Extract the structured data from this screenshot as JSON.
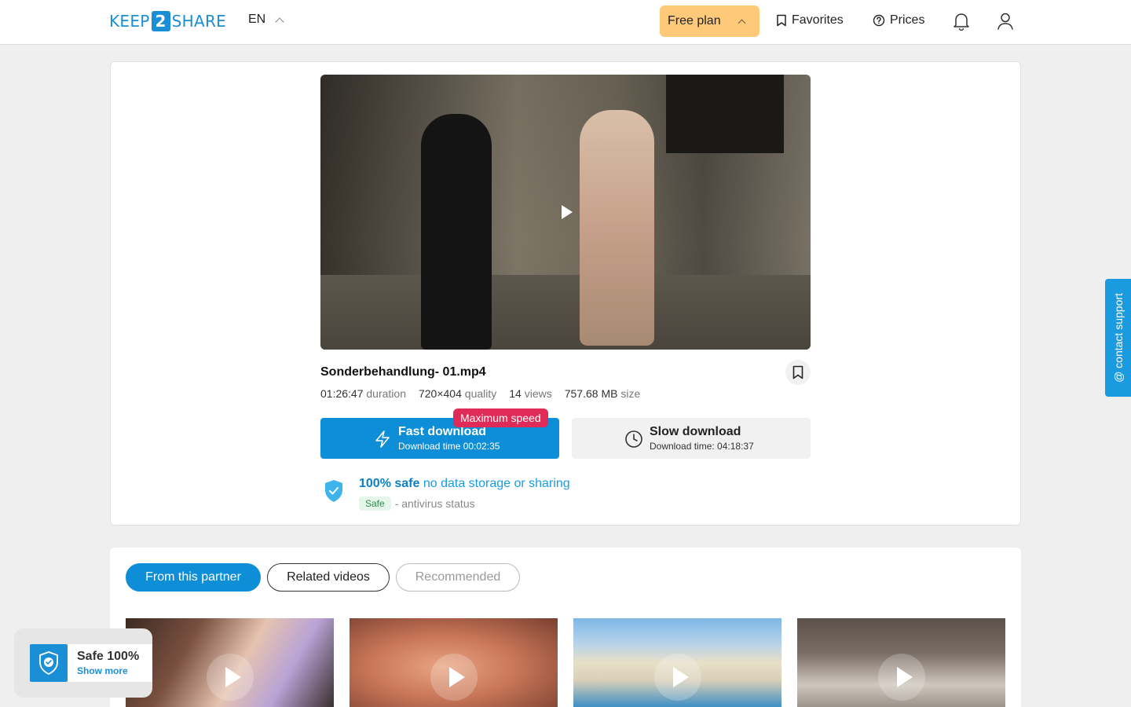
{
  "header": {
    "logo": {
      "part1": "KEEP",
      "part2": "2",
      "part3": "SHARE"
    },
    "language": "EN",
    "plan_label": "Free plan",
    "favorites_label": "Favorites",
    "prices_label": "Prices",
    "icons": {
      "bookmark": "bookmark-icon",
      "help": "help-circle-icon",
      "bell": "bell-icon",
      "user": "user-icon"
    }
  },
  "file": {
    "title": "Sonderbehandlung- 01.mp4",
    "duration_value": "01:26:47",
    "duration_label": "duration",
    "quality_value": "720×404",
    "quality_label": "quality",
    "views_value": "14",
    "views_label": "views",
    "size_value": "757.68 MB",
    "size_label": "size"
  },
  "download": {
    "badge": "Maximum speed",
    "fast_title": "Fast download",
    "fast_time": "Download time 00:02:35",
    "slow_title": "Slow download",
    "slow_time": "Download time: 04:18:37"
  },
  "safety": {
    "strong": "100% safe",
    "text": "no data storage or sharing",
    "tag": "Safe",
    "status_text": "- antivirus status"
  },
  "support_label": "@ contact support",
  "tabs": {
    "from_partner": "From this partner",
    "related": "Related videos",
    "recommended": "Recommended"
  },
  "safe_widget": {
    "title": "Safe 100%",
    "link": "Show more"
  },
  "colors": {
    "accent": "#0e8ed6",
    "plan": "#ffc97a",
    "badge": "#e02a57"
  }
}
